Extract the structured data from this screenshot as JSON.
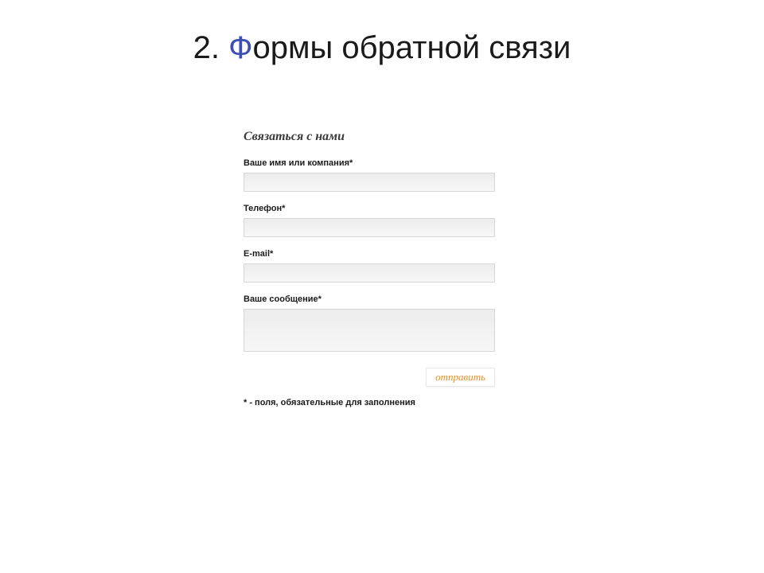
{
  "slide": {
    "title_prefix": "2. ",
    "title_first_letter": "Ф",
    "title_rest": "ормы обратной связи"
  },
  "form": {
    "heading": "Связаться с нами",
    "fields": {
      "name": {
        "label": "Ваше имя или компания*",
        "value": ""
      },
      "phone": {
        "label": "Телефон*",
        "value": ""
      },
      "email": {
        "label": "E-mail*",
        "value": ""
      },
      "message": {
        "label": "Ваше сообщение*",
        "value": ""
      }
    },
    "submit_label": "отправить",
    "required_note": "* - поля, обязательные для заполнения"
  }
}
